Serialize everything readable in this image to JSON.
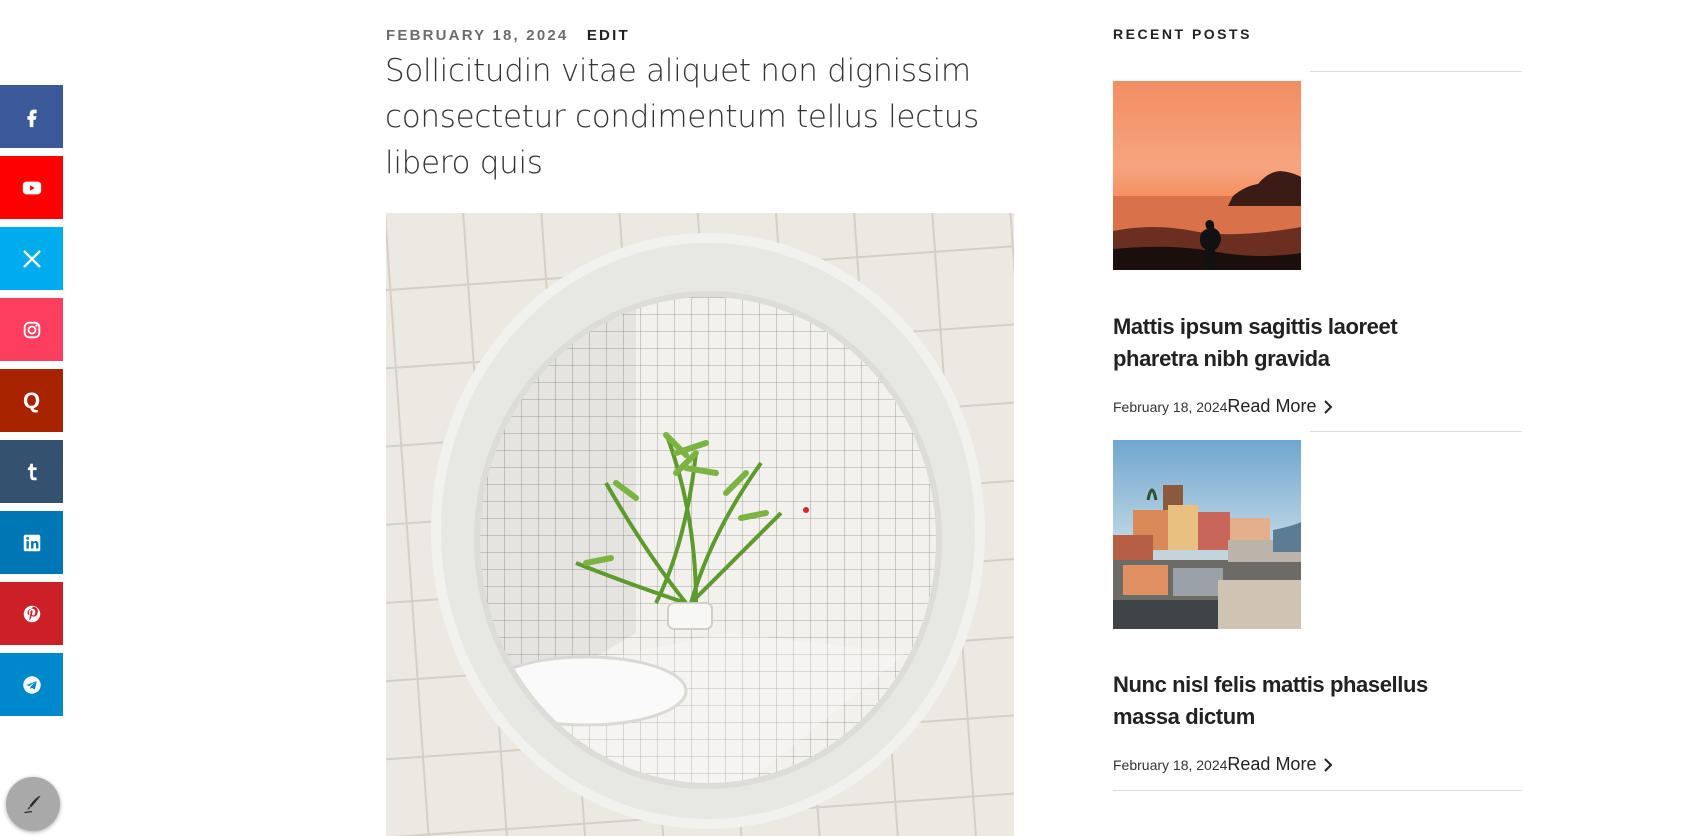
{
  "social": [
    {
      "name": "facebook",
      "icon": "facebook-icon",
      "color": "#3b5998"
    },
    {
      "name": "youtube",
      "icon": "youtube-icon",
      "color": "#ff0000"
    },
    {
      "name": "x",
      "icon": "x-icon",
      "color": "#00acee"
    },
    {
      "name": "instagram",
      "icon": "instagram-icon",
      "color": "#fd3e5f"
    },
    {
      "name": "quora",
      "icon": "quora-icon",
      "color": "#a82400",
      "glyph": "Q"
    },
    {
      "name": "tumblr",
      "icon": "tumblr-icon",
      "color": "#34526f"
    },
    {
      "name": "linkedin",
      "icon": "linkedin-icon",
      "color": "#0077b5"
    },
    {
      "name": "pinterest",
      "icon": "pinterest-icon",
      "color": "#cb2027"
    },
    {
      "name": "telegram",
      "icon": "telegram-icon",
      "color": "#0088cc"
    }
  ],
  "fab": {
    "icon": "pen-icon"
  },
  "post": {
    "date": "FEBRUARY 18, 2024",
    "edit": "EDIT",
    "title": "Sollicitudin vitae aliquet non dignissim consectetur condimentum tellus lectus libero quis"
  },
  "sidebar": {
    "title": "RECENT POSTS",
    "posts": [
      {
        "title": "Mattis ipsum sagittis laoreet pharetra nibh gravida",
        "date": "February 18, 2024",
        "read_more": "Read More"
      },
      {
        "title": "Nunc nisl felis mattis phasellus massa dictum",
        "date": "February 18, 2024",
        "read_more": "Read More"
      }
    ]
  }
}
